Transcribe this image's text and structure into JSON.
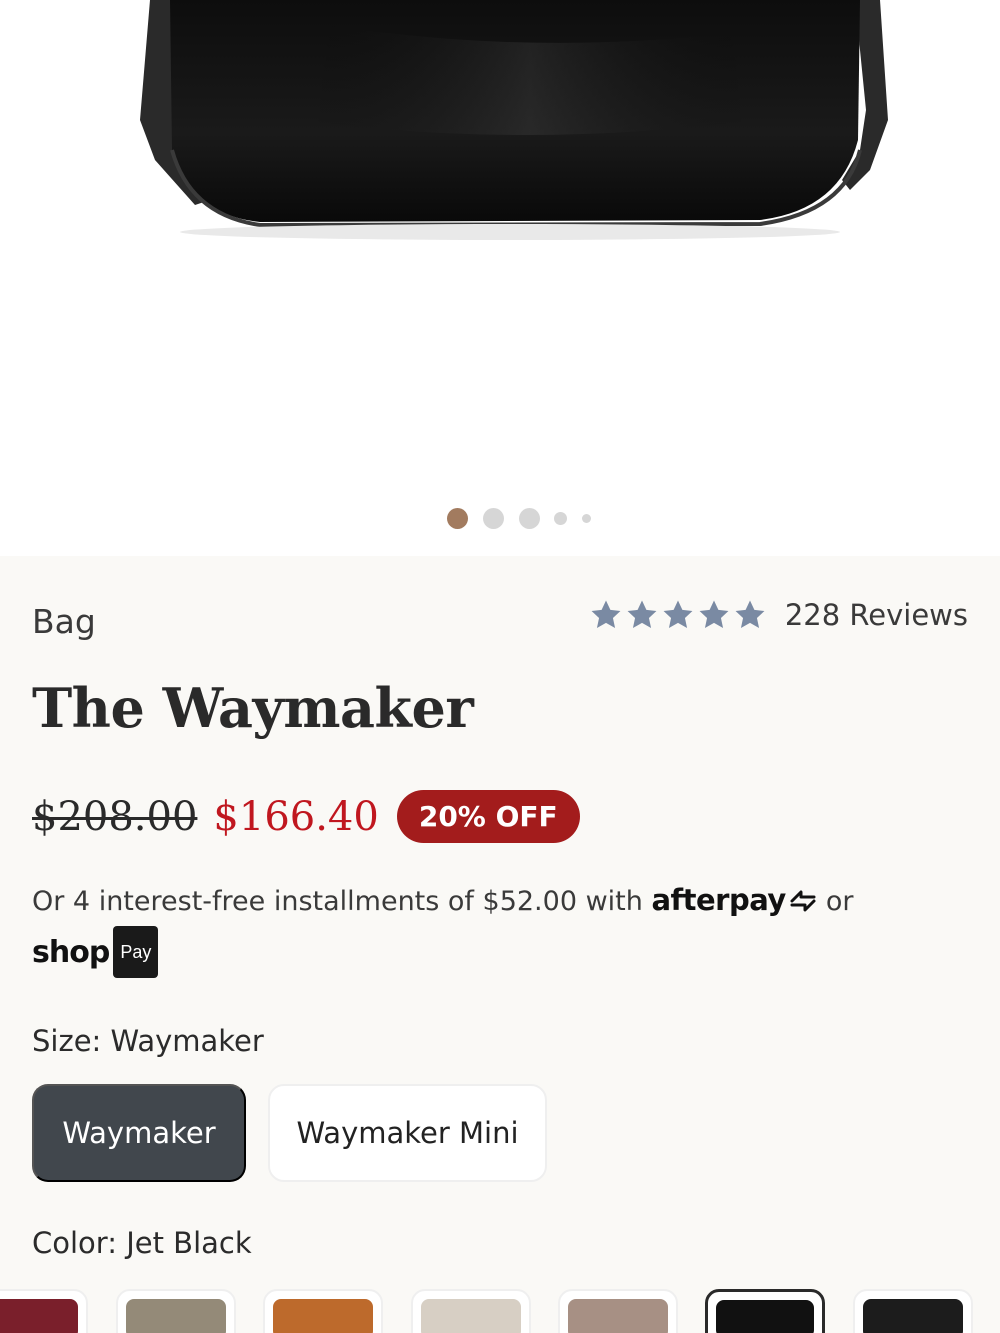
{
  "gallery": {
    "dots": [
      {
        "active": true,
        "color": "#a27b5f"
      },
      {
        "active": false,
        "color": "#d6d6d6"
      },
      {
        "active": false,
        "color": "#d6d6d6"
      },
      {
        "active": false,
        "color": "#d6d6d6"
      },
      {
        "active": false,
        "color": "#d6d6d6"
      }
    ]
  },
  "product": {
    "category": "Bag",
    "rating": {
      "stars": 5,
      "reviews_label": "228 Reviews",
      "star_color": "#7a8aa3"
    },
    "title": "The Waymaker",
    "price": {
      "original": "$208.00",
      "sale": "$166.40",
      "discount_badge": "20% OFF"
    },
    "installments": {
      "text": "Or 4 interest-free installments of $52.00 with",
      "afterpay": "afterpay",
      "or": "or",
      "shop": "shop",
      "pay": "Pay"
    },
    "size": {
      "label": "Size: Waymaker",
      "options": [
        {
          "label": "Waymaker",
          "selected": true
        },
        {
          "label": "Waymaker Mini",
          "selected": false
        }
      ]
    },
    "color": {
      "label": "Color: Jet Black",
      "swatches": [
        {
          "name": "burgundy",
          "color": "#7a1f2b",
          "selected": false
        },
        {
          "name": "taupe",
          "color": "#948a78",
          "selected": false
        },
        {
          "name": "cognac",
          "color": "#bd6a2c",
          "selected": false
        },
        {
          "name": "sand",
          "color": "#d7cfc4",
          "selected": false
        },
        {
          "name": "mauve",
          "color": "#a79084",
          "selected": false
        },
        {
          "name": "jet-black",
          "color": "#111111",
          "selected": true
        },
        {
          "name": "black-pebbled",
          "color": "#1c1c1c",
          "selected": false
        }
      ]
    }
  }
}
